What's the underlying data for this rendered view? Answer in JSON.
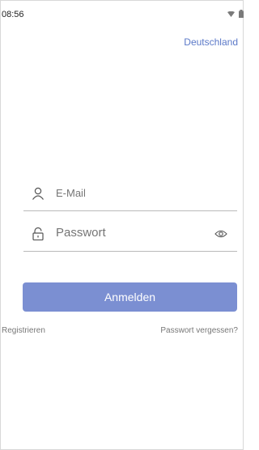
{
  "status_bar": {
    "time": "08:56",
    "icons": [
      "wifi-icon",
      "battery-icon"
    ]
  },
  "region": {
    "label": "Deutschland"
  },
  "login_form": {
    "email": {
      "placeholder": "E-Mail",
      "value": "",
      "icon": "user-icon"
    },
    "password": {
      "placeholder": "Passwort",
      "value": "",
      "icon": "lock-icon",
      "toggle_icon": "eye-icon"
    },
    "submit_label": "Anmelden"
  },
  "links": {
    "register": "Registrieren",
    "forgot_password": "Passwort vergessen?"
  },
  "colors": {
    "accent": "#5b79c8",
    "button": "#7b8fd2"
  }
}
